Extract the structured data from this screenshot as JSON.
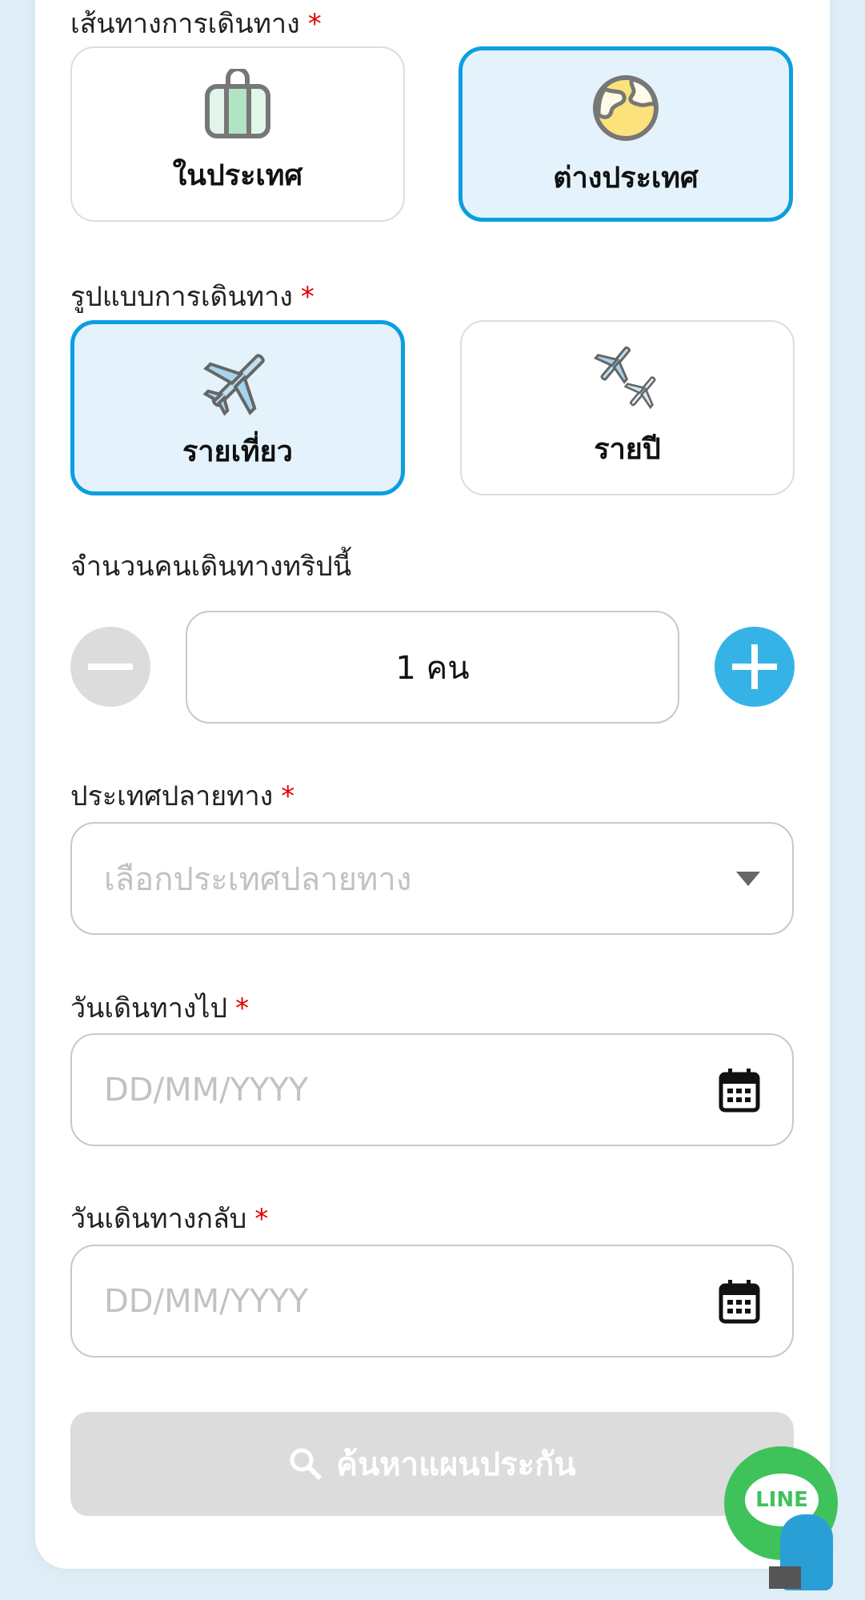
{
  "route": {
    "label": "เส้นทางการเดินทาง",
    "required": "*",
    "options": [
      {
        "label": "ในประเทศ",
        "icon": "luggage-icon",
        "selected": false
      },
      {
        "label": "ต่างประเทศ",
        "icon": "globe-icon",
        "selected": true
      }
    ]
  },
  "type": {
    "label": "รูปแบบการเดินทาง",
    "required": "*",
    "options": [
      {
        "label": "รายเที่ยว",
        "icon": "airplane-icon",
        "selected": true
      },
      {
        "label": "รายปี",
        "icon": "multiple-airplanes-icon",
        "selected": false
      }
    ]
  },
  "travelers": {
    "label": "จำนวนคนเดินทางทริปนี้",
    "value": "1 คน"
  },
  "destination": {
    "label": "ประเทศปลายทาง",
    "required": "*",
    "placeholder": "เลือกประเทศปลายทาง"
  },
  "depart": {
    "label": "วันเดินทางไป",
    "required": "*",
    "placeholder": "DD/MM/YYYY"
  },
  "return": {
    "label": "วันเดินทางกลับ",
    "required": "*",
    "placeholder": "DD/MM/YYYY"
  },
  "search_button": "ค้นหาแผนประกัน",
  "line_widget": "LINE",
  "colors": {
    "accent": "#0a9fe0",
    "selected_bg": "#e4f3fb",
    "plus": "#35b3e6",
    "disabled": "#dcdcdc",
    "line_green": "#3fc25a"
  }
}
